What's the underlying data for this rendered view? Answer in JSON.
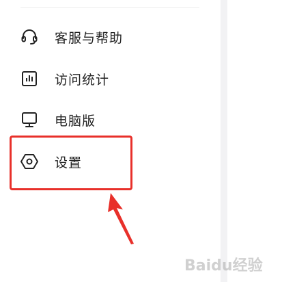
{
  "menu": {
    "items": [
      {
        "label": "客服与帮助",
        "icon": "headset-icon"
      },
      {
        "label": "访问统计",
        "icon": "bar-chart-icon"
      },
      {
        "label": "电脑版",
        "icon": "monitor-icon"
      },
      {
        "label": "设置",
        "icon": "settings-hexagon-icon"
      }
    ]
  },
  "annotation": {
    "highlight_color": "#e8302a",
    "highlighted_item": "设置"
  },
  "watermark": {
    "text": "Baidu经验"
  }
}
